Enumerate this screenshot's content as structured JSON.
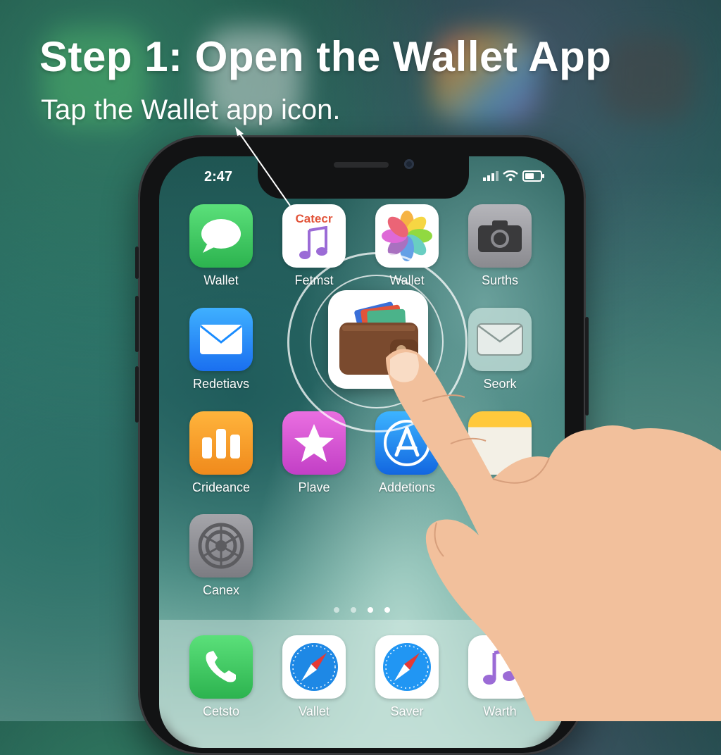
{
  "instruction": {
    "title": "Step 1: Open the Wallet App",
    "subtitle": "Tap the Wallet app icon."
  },
  "status_bar": {
    "time": "2:47"
  },
  "home_screen": {
    "apps": [
      {
        "label": "Wallet",
        "icon": "messages-icon"
      },
      {
        "label": "Fetmst",
        "icon": "music-note-icon",
        "icon_text": "Catecr"
      },
      {
        "label": "Wallet",
        "icon": "photos-icon"
      },
      {
        "label": "Surths",
        "icon": "camera-icon"
      },
      {
        "label": "Redetiavs",
        "icon": "mail-icon"
      },
      {
        "label": "Seork",
        "icon": "envelope-icon"
      },
      {
        "label": "Crideance",
        "icon": "bars-icon"
      },
      {
        "label": "Plave",
        "icon": "star-icon"
      },
      {
        "label": "Addetions",
        "icon": "app-store-icon"
      },
      {
        "label": "Canex",
        "icon": "settings-icon"
      }
    ],
    "highlighted_app": {
      "name": "Wallet",
      "icon": "wallet-icon"
    },
    "page_dots": {
      "count": 4,
      "active_index": 2
    }
  },
  "dock": {
    "apps": [
      {
        "label": "Cetsto",
        "icon": "phone-icon"
      },
      {
        "label": "Vallet",
        "icon": "safari-icon"
      },
      {
        "label": "Saver",
        "icon": "safari-icon"
      },
      {
        "label": "Warth",
        "icon": "music-icon"
      }
    ]
  },
  "colors": {
    "messages": "#34c759",
    "mail": "#1a8cff",
    "bars": "#f5a623",
    "star": "#d94fd1",
    "app_store": "#1e88e5",
    "settings": "#8e8e93",
    "camera": "#8a8a8f",
    "phone": "#34c759",
    "wallet_leather": "#7a4a2e",
    "skin": "#f2c09c"
  }
}
